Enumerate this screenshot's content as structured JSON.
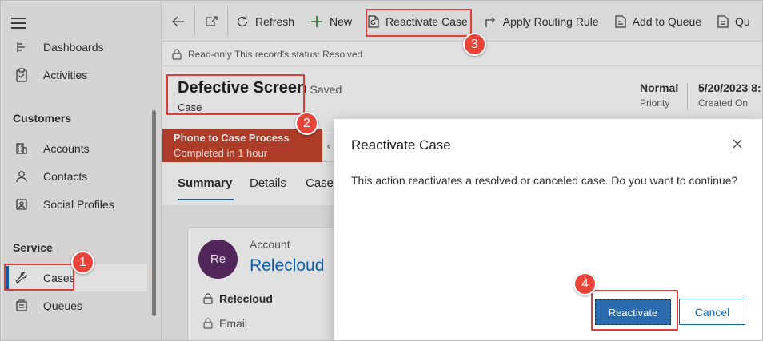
{
  "sidebar": {
    "items_top": [
      {
        "label": "Dashboards",
        "icon": "dashboard-icon"
      },
      {
        "label": "Activities",
        "icon": "clipboard-icon"
      }
    ],
    "groups": [
      {
        "title": "Customers",
        "items": [
          {
            "label": "Accounts",
            "icon": "building-icon"
          },
          {
            "label": "Contacts",
            "icon": "person-icon"
          },
          {
            "label": "Social Profiles",
            "icon": "social-profile-icon"
          }
        ]
      },
      {
        "title": "Service",
        "items": [
          {
            "label": "Cases",
            "icon": "wrench-icon",
            "selected": true
          },
          {
            "label": "Queues",
            "icon": "queue-icon"
          }
        ]
      }
    ]
  },
  "toolbar": {
    "refresh": "Refresh",
    "new": "New",
    "reactivate": "Reactivate Case",
    "routing": "Apply Routing Rule",
    "add_queue": "Add to Queue",
    "queue_more": "Qu"
  },
  "readonly": "Read-only This record's status: Resolved",
  "record": {
    "title": "Defective Screen",
    "saved": "- Saved",
    "type": "Case",
    "priority_value": "Normal",
    "priority_label": "Priority",
    "created_value": "5/20/2023 8:",
    "created_label": "Created On"
  },
  "process": {
    "title": "Phone to Case Process",
    "status": "Completed in 1 hour"
  },
  "tabs": [
    "Summary",
    "Details",
    "Case"
  ],
  "account": {
    "label": "Account",
    "link": "Relecloud",
    "avatar_initials": "Re",
    "name": "Relecloud",
    "email_label": "Email"
  },
  "dialog": {
    "title": "Reactivate Case",
    "message": "This action reactivates a resolved or canceled case. Do you want to continue?",
    "primary": "Reactivate",
    "secondary": "Cancel"
  },
  "callouts": [
    "1",
    "2",
    "3",
    "4"
  ],
  "colors": {
    "highlight": "#e03c3c",
    "badge": "#e8443a",
    "primary_button": "#2b6cb0",
    "process_bar": "#c5462e",
    "link": "#0f6cbd"
  }
}
